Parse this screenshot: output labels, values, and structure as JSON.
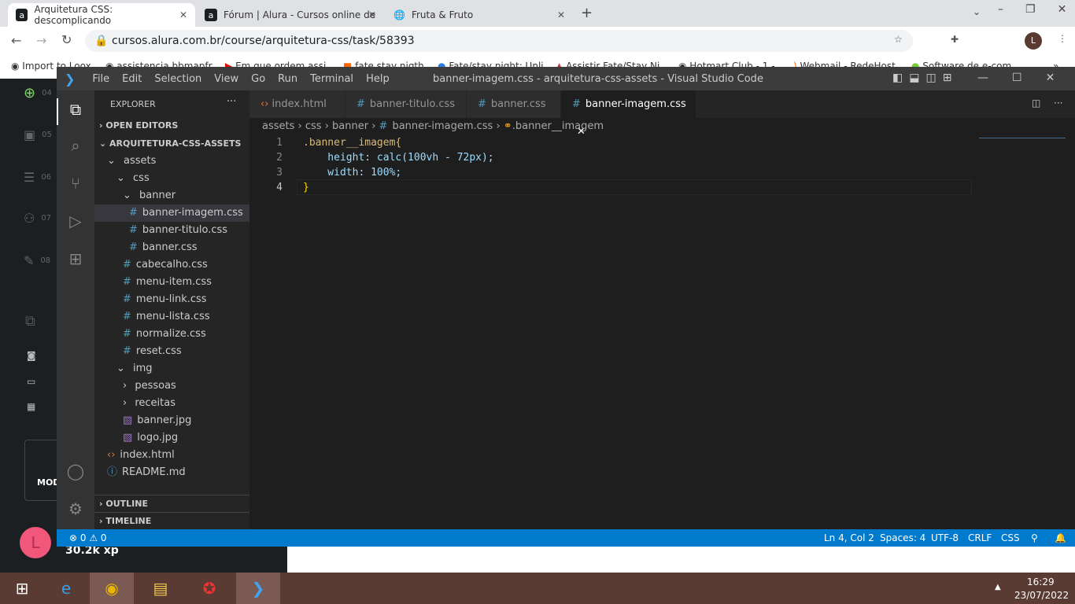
{
  "browser": {
    "tabs": [
      {
        "label": "Arquitetura CSS: descomplicando",
        "favicon": "a",
        "active": true
      },
      {
        "label": "Fórum | Alura - Cursos online de",
        "favicon": "a"
      },
      {
        "label": "Fruta & Fruto",
        "favicon": "globe"
      }
    ],
    "url": "cursos.alura.com.br/course/arquitetura-css/task/58393",
    "profile": "L",
    "bookmarks": [
      "Import to Loox",
      "assistencia bbmapfr",
      "Em que ordem assi",
      "fate stay nigth",
      "Fate/stay night: Unli",
      "Assistir Fate/Stay Ni",
      "Hotmart Club - 1 -",
      "Webmail - RedeHost",
      "Software de e-com"
    ]
  },
  "alura": {
    "nav": [
      "04",
      "05",
      "06",
      "07",
      "08"
    ],
    "avatar": "L",
    "xp": "30.2k xp",
    "mode_label": "MOD"
  },
  "vscode": {
    "menu": [
      "File",
      "Edit",
      "Selection",
      "View",
      "Go",
      "Run",
      "Terminal",
      "Help"
    ],
    "title": "banner-imagem.css - arquitetura-css-assets - Visual Studio Code",
    "explorer_label": "EXPLORER",
    "open_editors": "OPEN EDITORS",
    "project": "ARQUITETURA-CSS-ASSETS",
    "tree": [
      {
        "label": "assets",
        "type": "folder"
      },
      {
        "label": "css",
        "type": "folder"
      },
      {
        "label": "banner",
        "type": "folder"
      },
      {
        "label": "banner-imagem.css",
        "type": "css"
      },
      {
        "label": "banner-titulo.css",
        "type": "css"
      },
      {
        "label": "banner.css",
        "type": "css"
      },
      {
        "label": "cabecalho.css",
        "type": "css"
      },
      {
        "label": "menu-item.css",
        "type": "css"
      },
      {
        "label": "menu-link.css",
        "type": "css"
      },
      {
        "label": "menu-lista.css",
        "type": "css"
      },
      {
        "label": "normalize.css",
        "type": "css"
      },
      {
        "label": "reset.css",
        "type": "css"
      },
      {
        "label": "img",
        "type": "folder"
      },
      {
        "label": "pessoas",
        "type": "folder-closed"
      },
      {
        "label": "receitas",
        "type": "folder-closed"
      },
      {
        "label": "banner.jpg",
        "type": "image"
      },
      {
        "label": "logo.jpg",
        "type": "image"
      },
      {
        "label": "index.html",
        "type": "html"
      },
      {
        "label": "README.md",
        "type": "info"
      }
    ],
    "outline": "OUTLINE",
    "timeline": "TIMELINE",
    "tabs": [
      "index.html",
      "banner-titulo.css",
      "banner.css",
      "banner-imagem.css"
    ],
    "breadcrumb": [
      "assets",
      "css",
      "banner",
      "banner-imagem.css",
      ".banner__imagem"
    ],
    "code": [
      ".banner__imagem{",
      "    height: calc(100vh - 72px);",
      "    width: 100%;",
      "}"
    ],
    "status": {
      "errors": "0",
      "warnings": "0",
      "position": "Ln 4, Col 2",
      "spaces": "Spaces: 4",
      "encoding": "UTF-8",
      "eol": "CRLF",
      "language": "CSS"
    }
  },
  "taskbar": {
    "time": "16:29",
    "date": "23/07/2022"
  }
}
